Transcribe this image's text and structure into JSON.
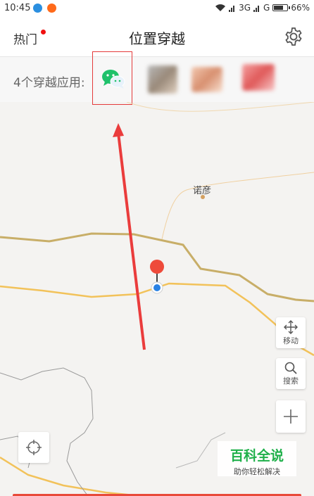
{
  "status_bar": {
    "time": "10:45",
    "network": "3G",
    "network2": "G",
    "battery": "66%",
    "battery_level": 0.66
  },
  "header": {
    "hot_tab_label": "热门",
    "title": "位置穿越",
    "settings_icon": "gear-icon"
  },
  "app_strip": {
    "label": "4个穿越应用:",
    "apps": [
      {
        "icon": "wechat-icon",
        "selected": true
      },
      {
        "icon": "blurred-app-icon"
      },
      {
        "icon": "blurred-app-icon"
      },
      {
        "icon": "blurred-app-icon"
      }
    ]
  },
  "map": {
    "place_name": "诺彦",
    "controls": {
      "move_label": "移动",
      "search_label": "搜索"
    }
  },
  "watermark": {
    "title": "百科全说",
    "subtitle": "助你轻松解决"
  },
  "colors": {
    "accent_red": "#e43b3b",
    "wechat_green": "#1fc16b",
    "road_yellow": "#f0c050",
    "road_brown": "#c8a860"
  }
}
